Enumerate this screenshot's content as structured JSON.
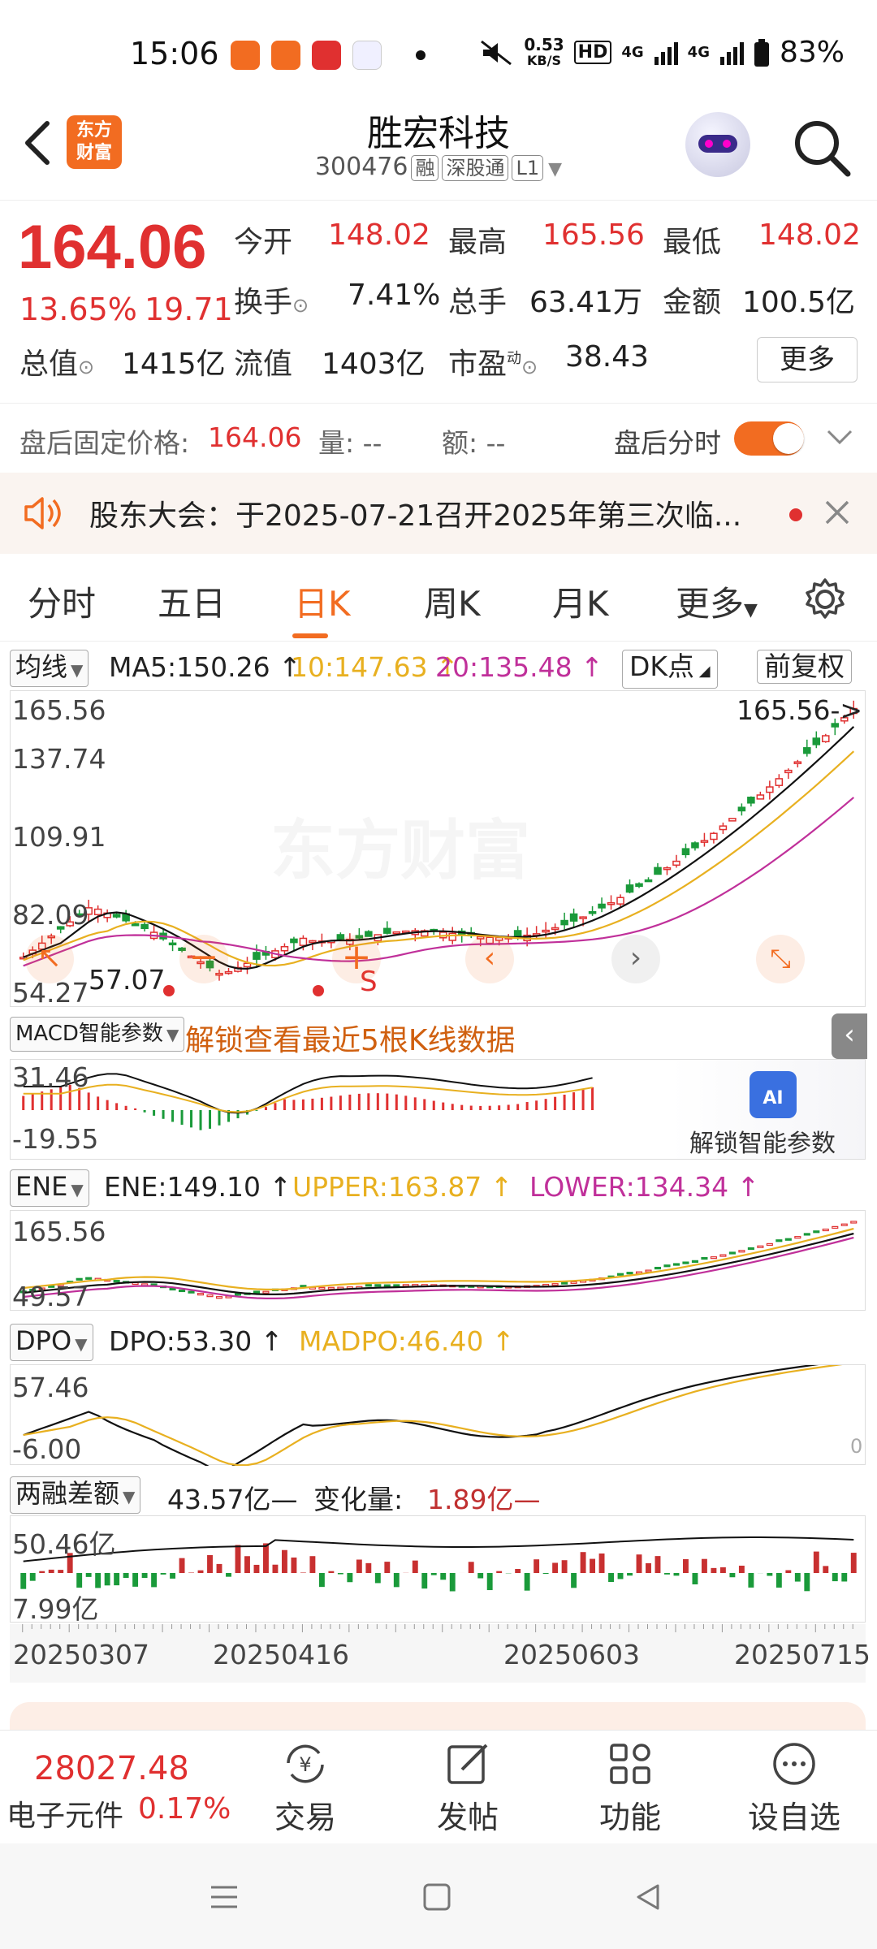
{
  "status_bar": {
    "time": "15:06",
    "net_speed_value": "0.53",
    "net_speed_unit": "KB/S",
    "hd": "HD",
    "signal1": "4G",
    "signal2": "4G",
    "battery": "83%"
  },
  "header": {
    "brand": "东方财富",
    "stock_name": "胜宏科技",
    "stock_code": "300476",
    "tags": [
      "融",
      "深股通",
      "L1"
    ]
  },
  "quote": {
    "price": "164.06",
    "change_pct": "13.65%",
    "change_abs": "19.71",
    "open_label": "今开",
    "open": "148.02",
    "high_label": "最高",
    "high": "165.56",
    "low_label": "最低",
    "low": "148.02",
    "turnover_label": "换手",
    "turnover": "7.41%",
    "volume_label": "总手",
    "volume": "63.41万",
    "amount_label": "金额",
    "amount": "100.5亿",
    "mcap_label": "总值",
    "mcap": "1415亿",
    "float_label": "流值",
    "float": "1403亿",
    "pe_label": "市盈",
    "pe_sup": "动",
    "pe": "38.43",
    "more_label": "更多"
  },
  "after_hours": {
    "price_label": "盘后固定价格:",
    "price": "164.06",
    "vol": "量: --",
    "amt": "额: --",
    "toggle_label": "盘后分时"
  },
  "notice": {
    "text": "股东大会：于2025-07-21召开2025年第三次临..."
  },
  "tabs": [
    "分时",
    "五日",
    "日K",
    "周K",
    "月K",
    "更多"
  ],
  "main_chart": {
    "ma_select": "均线",
    "ma5": "MA5:150.26",
    "ma10": "10:147.63",
    "ma20": "20:135.48",
    "dk_label": "DK点",
    "adjust_label": "前复权",
    "y_labels": [
      "165.56",
      "137.74",
      "109.91",
      "82.09",
      "54.27"
    ],
    "high_marker": "165.56->",
    "low_marker": "57.07",
    "watermark": "东方财富",
    "s_label": "S"
  },
  "macd": {
    "select": "MACD智能参数",
    "unlock_text": "解锁查看最近5根K线数据",
    "y_top": "31.46",
    "y_bottom": "-19.55",
    "ai_label": "AI",
    "ai_unlock": "解锁智能参数"
  },
  "ene": {
    "select": "ENE",
    "ene": "ENE:149.10",
    "upper": "UPPER:163.87",
    "lower": "LOWER:134.34",
    "y_top": "165.56",
    "y_bottom": "49.57"
  },
  "dpo": {
    "select": "DPO",
    "dpo": "DPO:53.30",
    "madpo": "MADPO:46.40",
    "y_top": "57.46",
    "y_bottom": "-6.00",
    "y_zero": "0"
  },
  "margin": {
    "select": "两融差额",
    "value": "43.57亿",
    "change_label": "变化量:",
    "change": "1.89亿",
    "y_top": "50.46亿",
    "y_bottom": "7.99亿"
  },
  "x_dates": [
    "20250307",
    "20250416",
    "20250603",
    "20250715"
  ],
  "bottom_nav": {
    "index_value": "28027.48",
    "index_name": "电子元件",
    "index_pct": "0.17%",
    "items": [
      "交易",
      "发帖",
      "功能",
      "设自选"
    ]
  },
  "colors": {
    "up": "#e03030",
    "down": "#1a9a3a",
    "accent": "#f26c21",
    "ma10": "#e8b020",
    "ma20": "#c0309a"
  }
}
